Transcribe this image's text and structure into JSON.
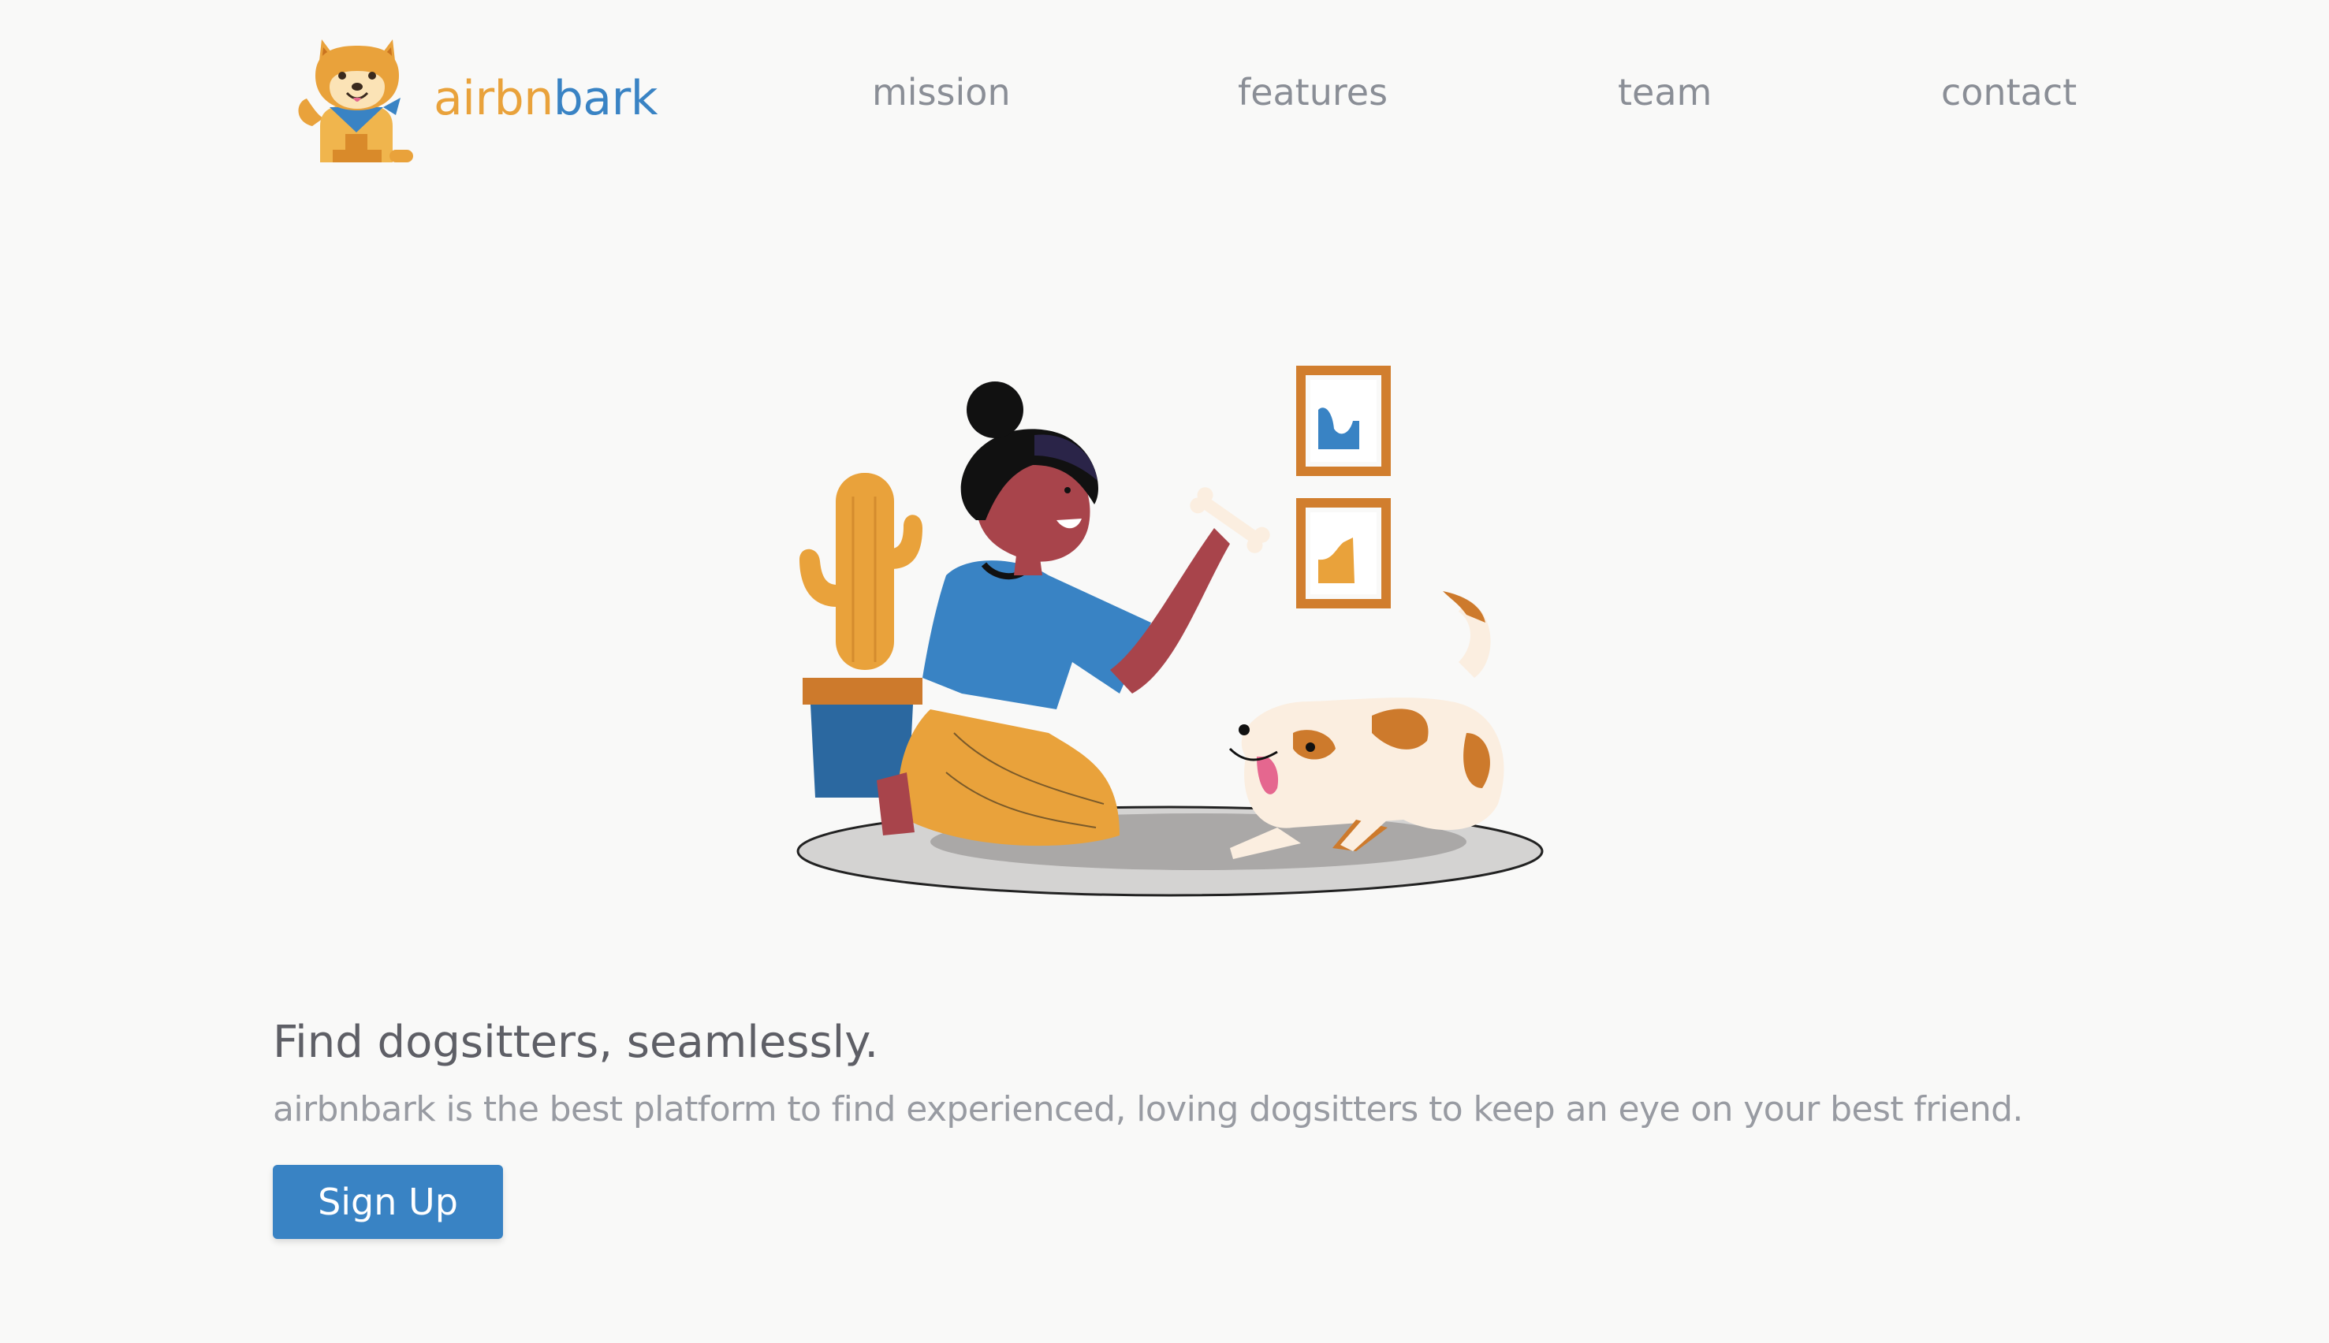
{
  "brand": {
    "name_part1": "airbn",
    "name_part2": "bark",
    "logo_icon": "shiba-dog-icon",
    "color_orange": "#e9a23b",
    "color_blue": "#3983c4"
  },
  "nav": {
    "items": [
      {
        "label": "mission"
      },
      {
        "label": "features"
      },
      {
        "label": "team"
      },
      {
        "label": "contact"
      }
    ]
  },
  "hero": {
    "illustration": "woman-giving-bone-to-dog-illustration",
    "headline": "Find dogsitters, seamlessly.",
    "subheadline": "airbnbark is the best platform to find experienced, loving dogsitters to keep an eye on your best friend.",
    "cta_label": "Sign Up"
  },
  "colors": {
    "background": "#f9f9f8",
    "nav_text": "#8a8e96",
    "headline_text": "#5e5f66",
    "subheadline_text": "#989ba2",
    "button": "#3983c4"
  }
}
